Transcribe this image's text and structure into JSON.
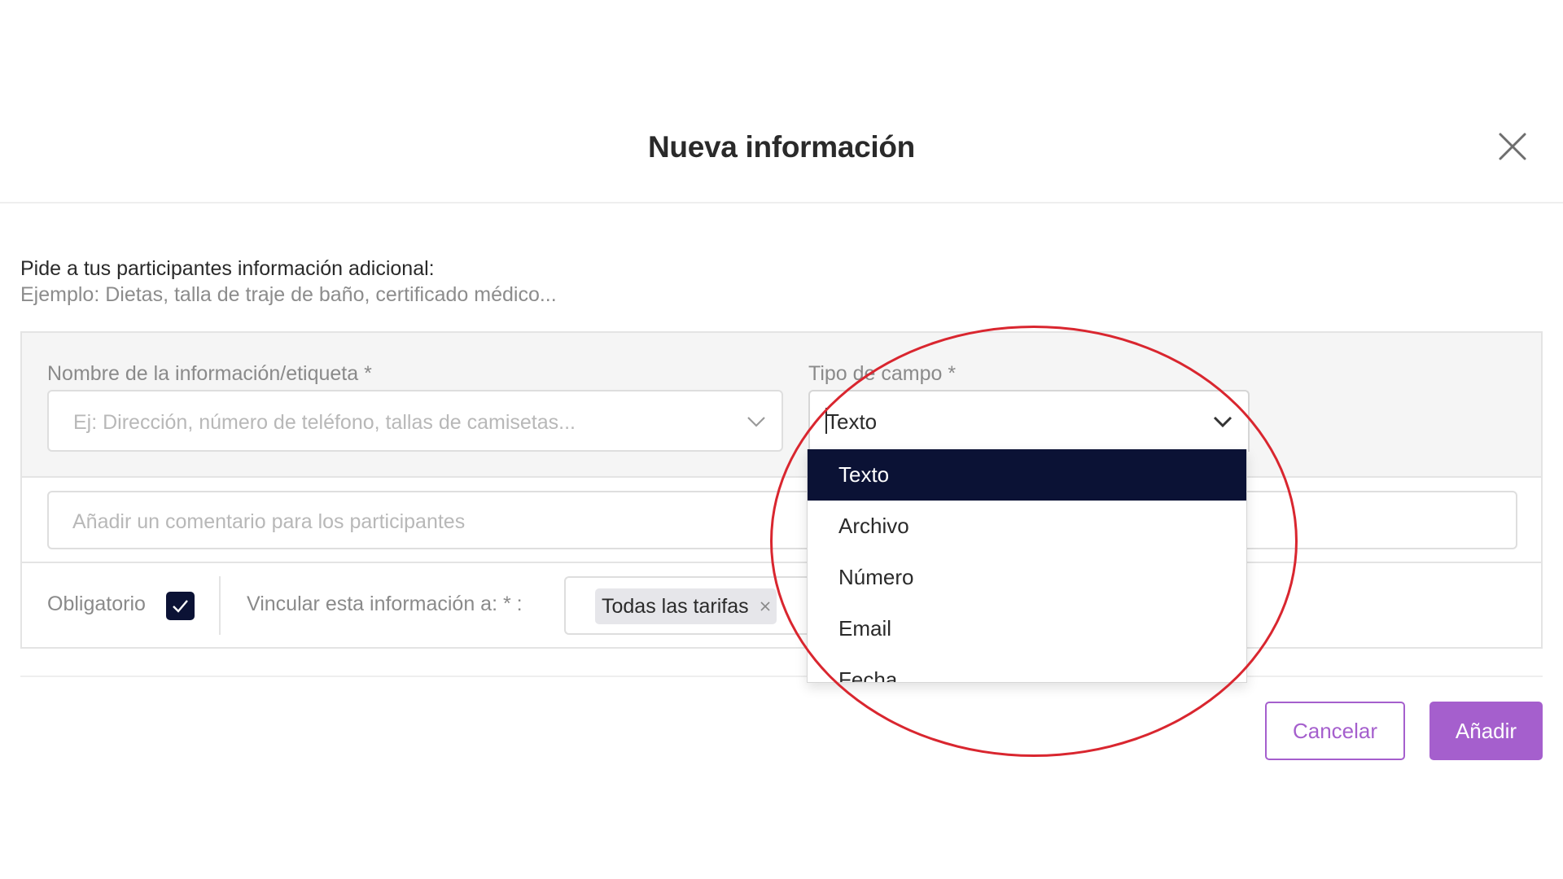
{
  "modal": {
    "title": "Nueva información"
  },
  "intro": {
    "title": "Pide a tus participantes información adicional:",
    "example": "Ejemplo: Dietas, talla de traje de baño, certificado médico..."
  },
  "form": {
    "name_label": "Nombre de la información/etiqueta *",
    "name_placeholder": "Ej: Dirección, número de teléfono, tallas de camisetas...",
    "type_label": "Tipo de campo *",
    "type_value": "Texto",
    "comment_placeholder": "Añadir un comentario para los participantes",
    "obligatorio_label": "Obligatorio",
    "obligatorio_checked": true,
    "vincular_label": "Vincular esta información a: * :",
    "tags": [
      "Todas las tarifas"
    ]
  },
  "dropdown": {
    "options": [
      "Texto",
      "Archivo",
      "Número",
      "Email",
      "Fecha"
    ],
    "selected": "Texto"
  },
  "buttons": {
    "cancel_label": "Cancelar",
    "add_label": "Añadir"
  },
  "colors": {
    "accent": "#a55fcd",
    "selected_bg": "#0b1235",
    "annotation": "#d9262f"
  },
  "icons": {
    "close": "close-icon",
    "chevron": "chevron-down-icon",
    "check": "check-icon",
    "tag_remove": "x-icon"
  }
}
